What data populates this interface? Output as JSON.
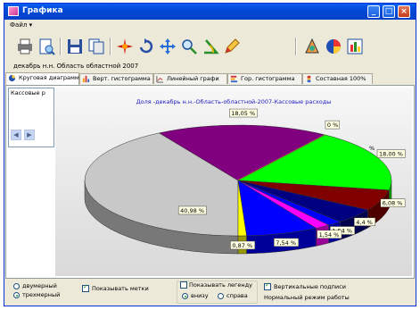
{
  "window": {
    "title": "Графика"
  },
  "menu": {
    "items": [
      "Файл ▾"
    ]
  },
  "subtitle": "декабрь н.н. Область областной 2007",
  "tabs": [
    {
      "label": "Круговая диаграмма",
      "icon": "pie-icon",
      "active": true
    },
    {
      "label": "Верт. гистограмма",
      "icon": "vbar-icon",
      "active": false
    },
    {
      "label": "Линейный графи",
      "icon": "line-icon",
      "active": false
    },
    {
      "label": "Гор. гистограмма",
      "icon": "hbar-icon",
      "active": false
    },
    {
      "label": "Составная 100%",
      "icon": "stacked-icon",
      "active": false
    }
  ],
  "side_list": {
    "value": "Кассовые р"
  },
  "chart_data": {
    "type": "pie",
    "title": "Доля -декабрь н.н.-Область-областной-2007-Кассовые расходы",
    "slices": [
      {
        "label": "40,98 %",
        "value": 40.98,
        "color": "#c8c8c8"
      },
      {
        "label": "18,05 %",
        "value": 18.05,
        "color": "#800080"
      },
      {
        "label": "0 %",
        "value": 0.0,
        "color": "#ffff00"
      },
      {
        "label": "18,00 %",
        "value": 18.0,
        "color": "#00ff00"
      },
      {
        "label": "6,08 %",
        "value": 6.08,
        "color": "#800000"
      },
      {
        "label": "4,4 %",
        "value": 4.4,
        "color": "#000080"
      },
      {
        "label": "1,54 %",
        "value": 1.54,
        "color": "#0000ff"
      },
      {
        "label": "1,54 %",
        "value": 1.54,
        "color": "#ff00ff"
      },
      {
        "label": "7,54 %",
        "value": 7.54,
        "color": "#0000ff"
      },
      {
        "label": "0,87 %",
        "value": 0.87,
        "color": "#ffff00"
      }
    ],
    "extra_labels": [
      "%"
    ]
  },
  "bottom": {
    "dim_2d": "двумерный",
    "dim_3d": "трехмерный",
    "show_marks": "Показывать метки",
    "show_legend": "Показывать легенду",
    "legend_bottom": "внизу",
    "legend_right": "справа",
    "vertical_labels": "Вертикальные подписи",
    "mode": "Нормальный режим работы"
  }
}
